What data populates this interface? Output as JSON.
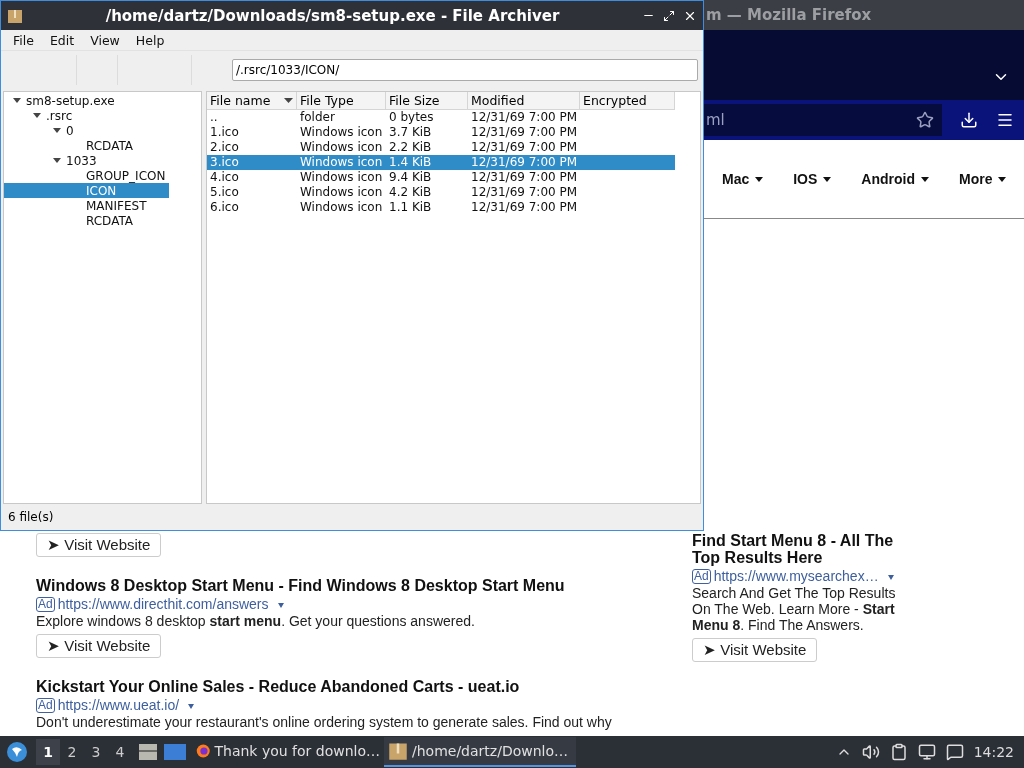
{
  "browser_window": {
    "title": "m — Mozilla Firefox",
    "address": "ml",
    "nav": [
      {
        "label": "Mac"
      },
      {
        "label": "IOS"
      },
      {
        "label": "Android"
      },
      {
        "label": "More"
      }
    ],
    "ads_left": [
      {
        "button": "➤ Visit Website"
      },
      {
        "title": "Windows 8 Desktop Start Menu - Find Windows 8 Desktop Start Menu",
        "badge": "Ad",
        "url": "https://www.directhit.com/answers",
        "description": "Explore windows 8 desktop **start menu**. Get your questions answered.",
        "button": "➤ Visit Website"
      },
      {
        "title": "Kickstart Your Online Sales - Reduce Abandoned Carts - ueat.io",
        "badge": "Ad",
        "url": "https://www.ueat.io/",
        "description": "Don't underestimate your restaurant's online ordering system to generate sales. Find out why"
      }
    ],
    "ads_right": [
      {
        "title": "Find Start Menu 8 - All The Top Results Here",
        "badge": "Ad",
        "url": "https://www.mysearchex…",
        "description": "Search And Get The Top Results On The Web. Learn More - **Start Menu 8**. Find The Answers.",
        "button": "➤ Visit Website"
      }
    ]
  },
  "archiver_window": {
    "title": "/home/dartz/Downloads/sm8-setup.exe - File Archiver",
    "menu": [
      "File",
      "Edit",
      "View",
      "Help"
    ],
    "path": "/.rsrc/1033/ICON/",
    "tree": [
      {
        "label": "sm8-setup.exe",
        "expanded": true,
        "selected": false,
        "children": [
          {
            "label": ".rsrc",
            "expanded": true,
            "selected": false,
            "children": [
              {
                "label": "0",
                "expanded": true,
                "selected": false,
                "children": [
                  {
                    "label": "RCDATA",
                    "selected": false
                  }
                ]
              },
              {
                "label": "1033",
                "expanded": true,
                "selected": false,
                "children": [
                  {
                    "label": "GROUP_ICON",
                    "selected": false
                  },
                  {
                    "label": "ICON",
                    "selected": true
                  },
                  {
                    "label": "MANIFEST",
                    "selected": false
                  },
                  {
                    "label": "RCDATA",
                    "selected": false
                  }
                ]
              }
            ]
          }
        ]
      }
    ],
    "columns": [
      {
        "label": "File name",
        "sorted": true
      },
      {
        "label": "File Type",
        "sorted": false
      },
      {
        "label": "File Size",
        "sorted": false
      },
      {
        "label": "Modified",
        "sorted": false
      },
      {
        "label": "Encrypted",
        "sorted": false
      }
    ],
    "rows": [
      {
        "cells": [
          "..",
          "folder",
          "0 bytes",
          "12/31/69 7:00 PM"
        ],
        "selected": false
      },
      {
        "cells": [
          "1.ico",
          "Windows icon",
          "3.7 KiB",
          "12/31/69 7:00 PM"
        ],
        "selected": false
      },
      {
        "cells": [
          "2.ico",
          "Windows icon",
          "2.2 KiB",
          "12/31/69 7:00 PM"
        ],
        "selected": false
      },
      {
        "cells": [
          "3.ico",
          "Windows icon",
          "1.4 KiB",
          "12/31/69 7:00 PM"
        ],
        "selected": true
      },
      {
        "cells": [
          "4.ico",
          "Windows icon",
          "9.4 KiB",
          "12/31/69 7:00 PM"
        ],
        "selected": false
      },
      {
        "cells": [
          "5.ico",
          "Windows icon",
          "4.2 KiB",
          "12/31/69 7:00 PM"
        ],
        "selected": false
      },
      {
        "cells": [
          "6.ico",
          "Windows icon",
          "1.1 KiB",
          "12/31/69 7:00 PM"
        ],
        "selected": false
      }
    ],
    "status": "6 file(s)"
  },
  "taskbar": {
    "workspaces": [
      {
        "label": "1",
        "selected": true
      },
      {
        "label": "2",
        "selected": false
      },
      {
        "label": "3",
        "selected": false
      },
      {
        "label": "4",
        "selected": false
      }
    ],
    "tasks": [
      {
        "kind": "browser",
        "label": "Thank you for downlo…",
        "selected": false
      },
      {
        "kind": "archive",
        "label": "/home/dartz/Downlo…",
        "selected": true
      }
    ],
    "clock": "14:22"
  }
}
